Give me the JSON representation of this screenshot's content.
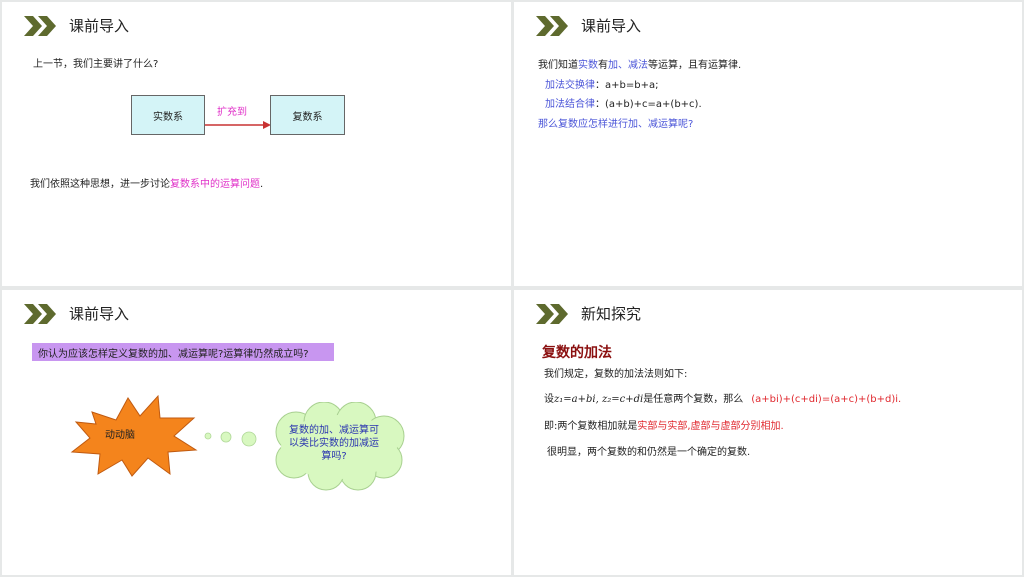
{
  "colors": {
    "chevron": "#5e6a2e",
    "pink": "#e030c8",
    "blue": "#4b55d8",
    "red": "#e0282e",
    "heading": "#8b1010",
    "banner": "#c896f0",
    "box": "#d4f4f7",
    "burst": "#f4841c",
    "cloud": "#d8f8c0"
  },
  "slide1": {
    "title": "课前导入",
    "question": "上一节，我们主要讲了什么?",
    "box_left": "实数系",
    "arrow_label": "扩充到",
    "box_right": "复数系",
    "summary_prefix": "我们依照这种思想，进一步讨论",
    "summary_highlight": "复数系中的运算问题",
    "summary_suffix": "."
  },
  "slide2": {
    "title": "课前导入",
    "line1_a": "我们知道",
    "line1_b": "实数",
    "line1_c": "有",
    "line1_d": "加、减法",
    "line1_e": "等运算，且有运算律.",
    "law1_label": "加法交换律",
    "law1_formula": "：a+b=b+a;",
    "law2_label": "加法结合律",
    "law2_formula": "：(a+b)+c=a+(b+c).",
    "question": "那么复数应怎样进行加、减运算呢?"
  },
  "slide3": {
    "title": "课前导入",
    "banner": "你认为应该怎样定义复数的加、减运算呢?运算律仍然成立吗?",
    "burst_label": "动动脑",
    "cloud_text": "复数的加、减运算可以类比实数的加减运算吗?"
  },
  "slide4": {
    "title": "新知探究",
    "heading": "复数的加法",
    "line1": "我们规定，复数的加法法则如下:",
    "line2_prefix": "设",
    "line2_vars": "z₁=a+bi, z₂=c+di",
    "line2_mid": "是任意两个复数，那么",
    "line2_formula": "(a+bi)+(c+di)=(a+c)+(b+d)i.",
    "line3_prefix": "即:两个复数相加就是",
    "line3_highlight": "实部与实部,虚部与虚部分别相加.",
    "line4": "很明显，两个复数的和仍然是一个确定的复数."
  }
}
